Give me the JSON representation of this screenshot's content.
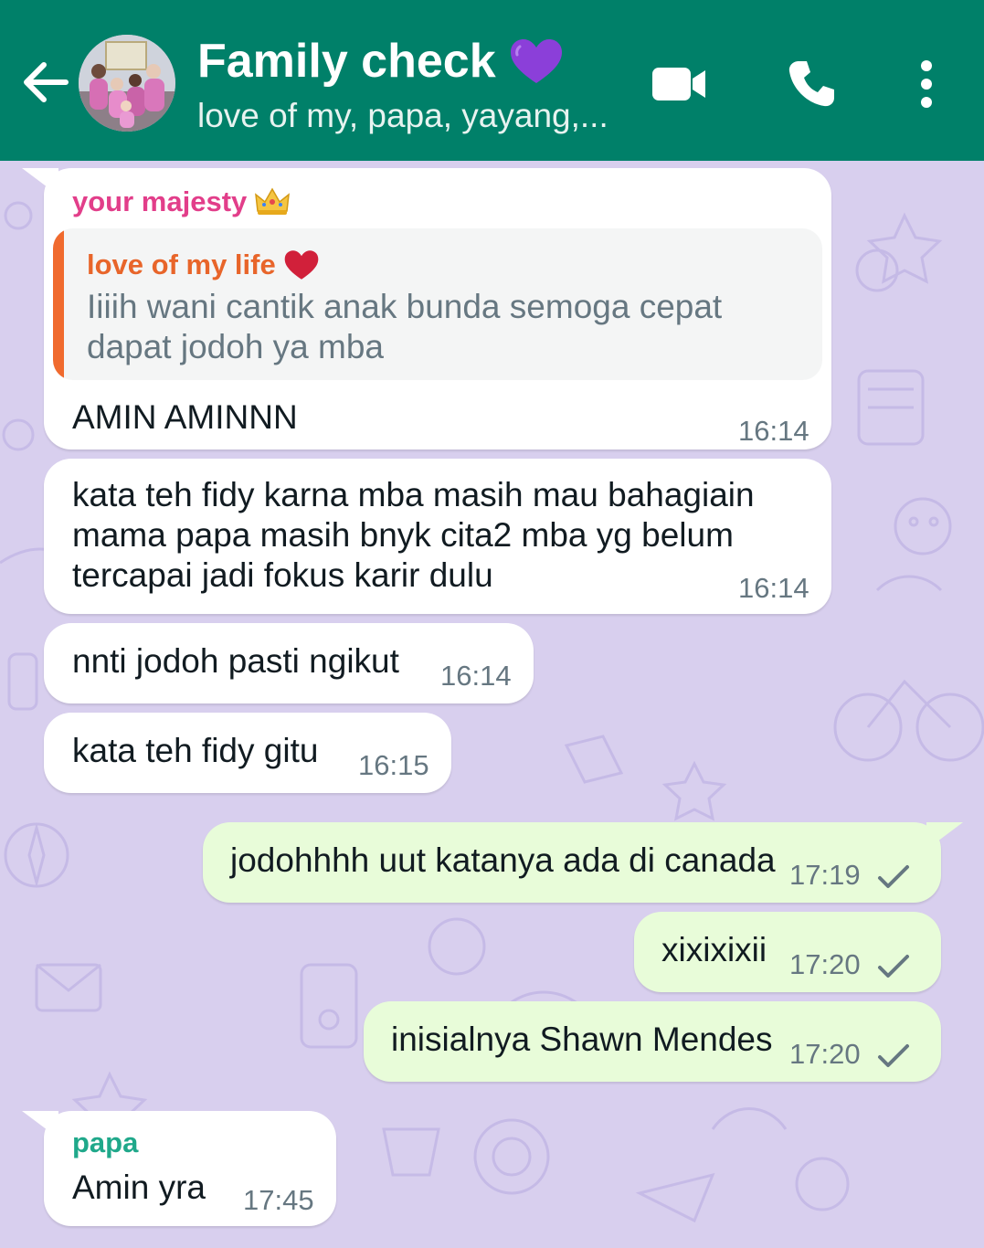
{
  "header": {
    "title": "Family check",
    "subtitle": "love of my, papa, yayang,...",
    "colors": {
      "bar": "#008069",
      "text": "#ffffff"
    },
    "icons": [
      "back-arrow-icon",
      "purple-heart-icon",
      "video-call-icon",
      "voice-call-icon",
      "more-options-icon"
    ]
  },
  "messages": [
    {
      "direction": "incoming",
      "sender": "your majesty",
      "sender_emoji": "crown",
      "sender_color": "#e23e8a",
      "quoted": {
        "name": "love of my life",
        "name_emoji": "red-heart",
        "name_color": "#e8652a",
        "text": "Iiiih wani cantik anak bunda semoga cepat dapat jodoh ya mba"
      },
      "text": "AMIN AMINNN",
      "time": "16:14"
    },
    {
      "direction": "incoming",
      "lines": [
        "kata teh fidy karna mba masih mau bahagiain",
        "mama papa masih bnyk cita2 mba yg belum",
        "tercapai jadi fokus karir dulu"
      ],
      "time": "16:14"
    },
    {
      "direction": "incoming",
      "text": "nnti jodoh pasti ngikut",
      "time": "16:14"
    },
    {
      "direction": "incoming",
      "text": "kata teh fidy gitu",
      "time": "16:15"
    },
    {
      "direction": "outgoing",
      "text": "jodohhhh uut katanya ada di canada",
      "time": "17:19",
      "status": "sent"
    },
    {
      "direction": "outgoing",
      "text": "xixixixii",
      "time": "17:20",
      "status": "sent"
    },
    {
      "direction": "outgoing",
      "text": "inisialnya Shawn Mendes",
      "time": "17:20",
      "status": "sent"
    },
    {
      "direction": "incoming",
      "sender": "papa",
      "sender_color": "#1fa88a",
      "text": "Amin yra",
      "time": "17:45"
    }
  ],
  "theme": {
    "wallpaper": "#d8cfee",
    "incoming_bubble": "#ffffff",
    "outgoing_bubble": "#e8fcd9",
    "timestamp": "#667781"
  }
}
